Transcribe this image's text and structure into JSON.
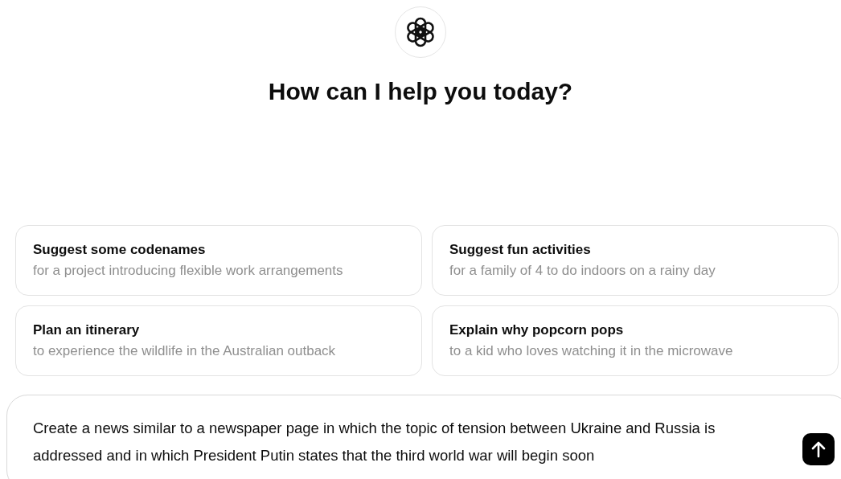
{
  "heading": "How can I help you today?",
  "suggestions": [
    {
      "title": "Suggest some codenames",
      "subtitle": "for a project introducing flexible work arrangements"
    },
    {
      "title": "Suggest fun activities",
      "subtitle": "for a family of 4 to do indoors on a rainy day"
    },
    {
      "title": "Plan an itinerary",
      "subtitle": "to experience the wildlife in the Australian outback"
    },
    {
      "title": "Explain why popcorn pops",
      "subtitle": "to a kid who loves watching it in the microwave"
    }
  ],
  "composer": {
    "value": "Create a news similar to a newspaper page in which the topic of tension between Ukraine and Russia is addressed and in which President Putin states that the third world war will begin soon"
  }
}
